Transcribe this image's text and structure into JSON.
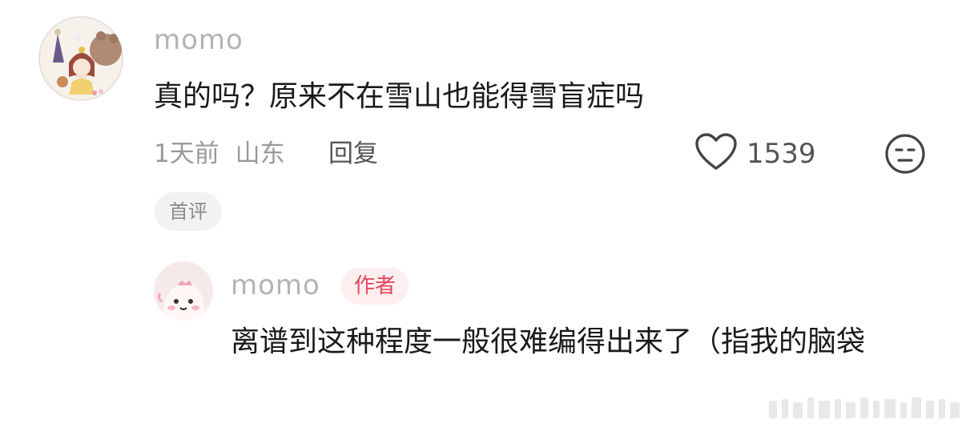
{
  "comment": {
    "username": "momo",
    "text": "真的吗？原来不在雪山也能得雪盲症吗",
    "time": "1天前",
    "location": "山东",
    "reply_label": "回复",
    "like_count": "1539",
    "badge": "首评"
  },
  "reply": {
    "username": "momo",
    "author_badge": "作者",
    "text": "离谱到这种程度一般很难编得出来了（指我的脑袋"
  },
  "colors": {
    "username": "#b3b3b3",
    "author_badge_text": "#e8465c",
    "author_badge_bg": "#fdeef0"
  },
  "icons": [
    "heart-icon",
    "dislike-face-icon"
  ]
}
